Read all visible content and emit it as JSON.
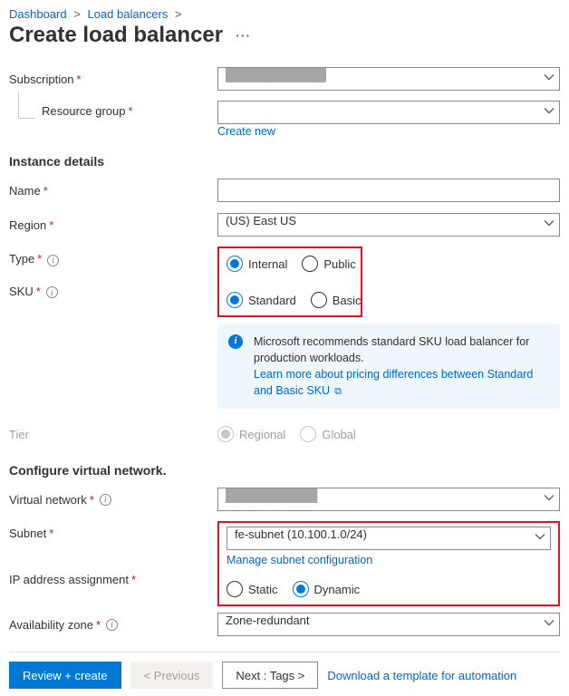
{
  "breadcrumb": {
    "l1": "Dashboard",
    "l2": "Load balancers",
    "sep": ">"
  },
  "title": "Create load balancer",
  "ellipsis": "···",
  "form": {
    "subscription": {
      "label": "Subscription",
      "value": "████████████"
    },
    "resource_group": {
      "label": "Resource group",
      "value": "",
      "create_new": "Create new"
    },
    "instance_heading": "Instance details",
    "name": {
      "label": "Name",
      "value": ""
    },
    "region": {
      "label": "Region",
      "value": "(US) East US"
    },
    "type": {
      "label": "Type",
      "opt1": "Internal",
      "opt2": "Public"
    },
    "sku": {
      "label": "SKU",
      "opt1": "Standard",
      "opt2": "Basic"
    },
    "sku_info": {
      "text": "Microsoft recommends standard SKU load balancer for production workloads.",
      "link": "Learn more about pricing differences between Standard and Basic SKU"
    },
    "tier": {
      "label": "Tier",
      "opt1": "Regional",
      "opt2": "Global"
    },
    "vnet_heading": "Configure virtual network.",
    "vnet": {
      "label": "Virtual network",
      "value": "███████████"
    },
    "subnet": {
      "label": "Subnet",
      "value": "fe-subnet (10.100.1.0/24)",
      "manage": "Manage subnet configuration"
    },
    "ip_assign": {
      "label": "IP address assignment",
      "opt1": "Static",
      "opt2": "Dynamic"
    },
    "az": {
      "label": "Availability zone",
      "value": "Zone-redundant"
    }
  },
  "footer": {
    "review": "Review + create",
    "prev": "< Previous",
    "next": "Next : Tags >",
    "download": "Download a template for automation"
  }
}
